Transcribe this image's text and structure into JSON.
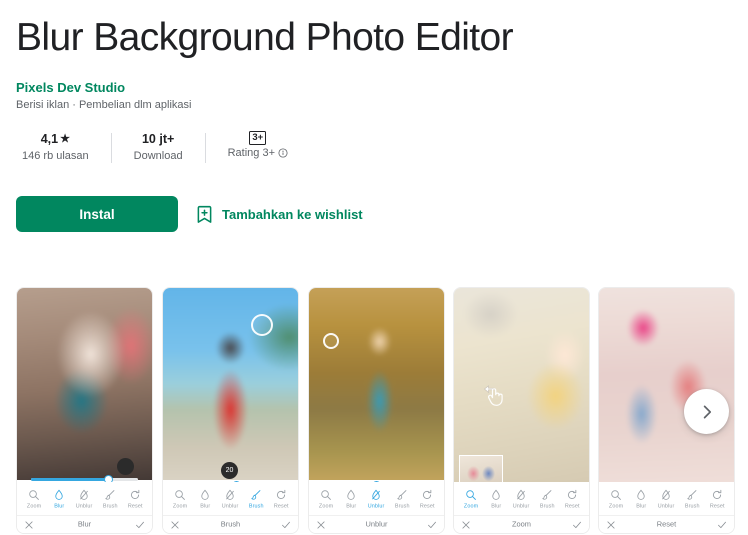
{
  "app": {
    "title": "Blur Background Photo Editor",
    "developer": "Pixels Dev Studio",
    "tags": "Berisi iklan · Pembelian dlm aplikasi"
  },
  "stats": [
    {
      "top": "4,1",
      "star": "★",
      "bottom": "146 rb ulasan",
      "badge": null,
      "info": false
    },
    {
      "top": "10 jt+",
      "star": "",
      "bottom": "Download",
      "badge": null,
      "info": false
    },
    {
      "top": "",
      "star": "",
      "bottom": "Rating 3+",
      "badge": "3+",
      "info": true
    }
  ],
  "actions": {
    "install_label": "Instal",
    "wishlist_label": "Tambahkan ke wishlist"
  },
  "colors": {
    "accent_green": "#01875f",
    "tool_blue": "#35a7e0",
    "text_primary": "#202124",
    "text_secondary": "#5f6368"
  },
  "screenshots": [
    {
      "active_tool": "Blur",
      "bottom_label": "Blur",
      "tools": [
        "Zoom",
        "Blur",
        "Unblur",
        "Brush",
        "Reset"
      ],
      "slider": {
        "visible": true,
        "fill_percent": 72,
        "badge": null
      }
    },
    {
      "active_tool": "Brush",
      "bottom_label": "Brush",
      "tools": [
        "Zoom",
        "Blur",
        "Unblur",
        "Brush",
        "Reset"
      ],
      "slider": {
        "visible": true,
        "fill_percent": 56,
        "badge": "20"
      }
    },
    {
      "active_tool": "Unblur",
      "bottom_label": "Unblur",
      "tools": [
        "Zoom",
        "Blur",
        "Unblur",
        "Brush",
        "Reset"
      ],
      "slider": {
        "visible": true,
        "fill_percent": 50,
        "badge": null
      }
    },
    {
      "active_tool": "Zoom",
      "bottom_label": "Zoom",
      "tools": [
        "Zoom",
        "Blur",
        "Unblur",
        "Brush",
        "Reset"
      ],
      "slider": {
        "visible": false,
        "fill_percent": 0,
        "badge": null
      }
    },
    {
      "active_tool": "Reset",
      "bottom_label": "Reset",
      "tools": [
        "Zoom",
        "Blur",
        "Unblur",
        "Brush",
        "Reset"
      ],
      "slider": {
        "visible": false,
        "fill_percent": 0,
        "badge": null
      }
    }
  ],
  "carousel": {
    "next_label": "›"
  }
}
